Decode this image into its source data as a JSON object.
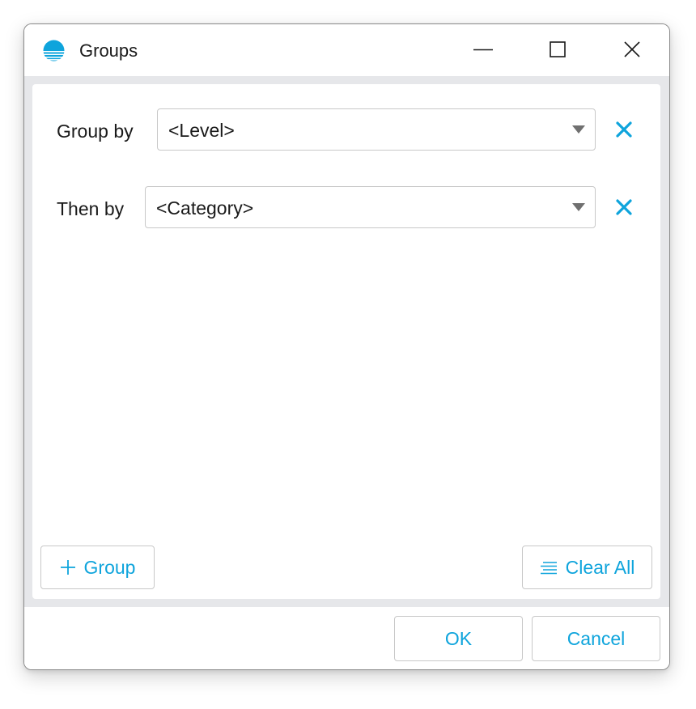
{
  "window": {
    "title": "Groups",
    "app_icon": "sunset-icon",
    "controls": {
      "minimize_icon": "minimize-icon",
      "maximize_icon": "maximize-icon",
      "close_icon": "close-icon"
    }
  },
  "groups": [
    {
      "label": "Group by",
      "value": "<Level>",
      "remove_icon": "remove-x-icon"
    },
    {
      "label": "Then by",
      "value": "<Category>",
      "remove_icon": "remove-x-icon"
    }
  ],
  "actions": {
    "add_group_label": "Group",
    "add_group_icon": "plus-icon",
    "clear_all_label": "Clear All",
    "clear_all_icon": "clear-lines-icon"
  },
  "footer": {
    "ok_label": "OK",
    "cancel_label": "Cancel"
  },
  "colors": {
    "accent": "#0ea4dc",
    "panel_bg": "#e6e7ea",
    "border": "#c8c8c8"
  }
}
